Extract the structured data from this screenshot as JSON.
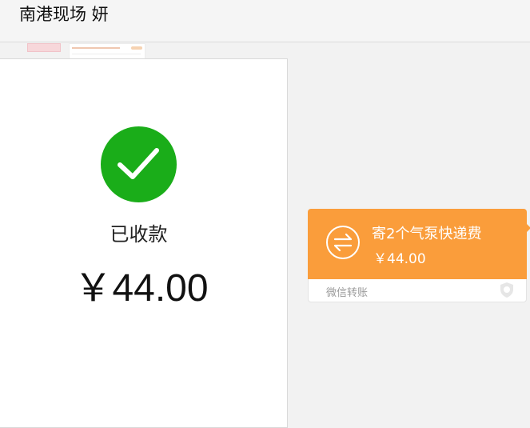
{
  "window": {
    "title": "南港现场 妍 "
  },
  "receipt": {
    "status": "已收款",
    "amount": "￥44.00"
  },
  "transfer_bubble": {
    "memo": "寄2个气泵快递费",
    "amount": "￥44.00",
    "footer_label": "微信转账"
  },
  "colors": {
    "success_green": "#1aad19",
    "transfer_orange": "#fa9d3b"
  },
  "icons": {
    "check": "check-icon",
    "transfer": "transfer-arrows-icon",
    "shield": "shield-icon"
  }
}
